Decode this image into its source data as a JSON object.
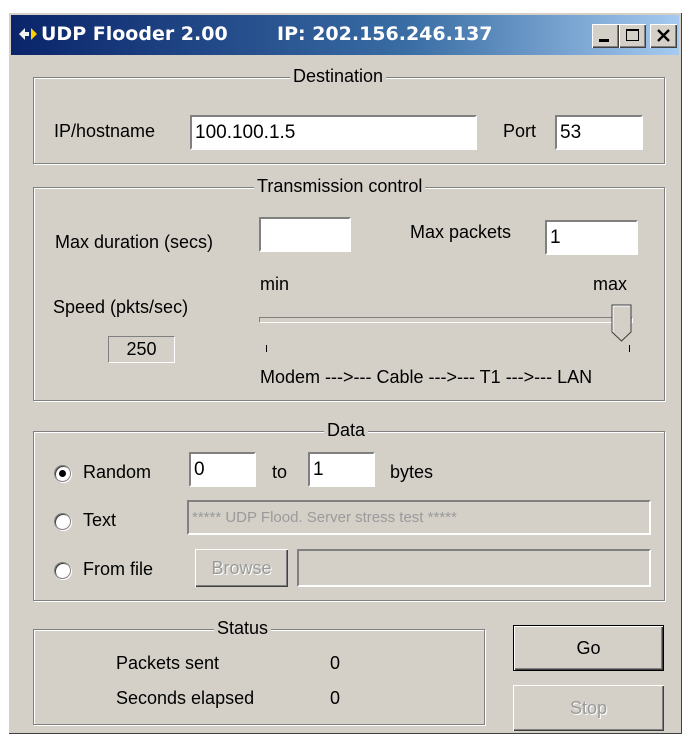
{
  "window": {
    "title": "UDP Flooder 2.00",
    "ip_label": "IP: 202.156.246.137",
    "controls": [
      "minimize",
      "maximize",
      "close"
    ]
  },
  "destination": {
    "legend": "Destination",
    "ip_label": "IP/hostname",
    "ip_value": "100.100.1.5",
    "port_label": "Port",
    "port_value": "53"
  },
  "transmission": {
    "legend": "Transmission control",
    "max_duration_label": "Max duration (secs)",
    "max_duration_value": "",
    "max_packets_label": "Max packets",
    "max_packets_value": "1",
    "speed_label": "Speed (pkts/sec)",
    "speed_value": "250",
    "slider_min": "min",
    "slider_max": "max",
    "slider_level": 1.0,
    "scale_text": "Modem --->--- Cable --->--- T1 --->--- LAN"
  },
  "data": {
    "legend": "Data",
    "random_label": "Random",
    "random_from": "0",
    "to_label": "to",
    "random_to": "1",
    "bytes_label": "bytes",
    "text_label": "Text",
    "text_value": "***** UDP Flood. Server stress test *****",
    "file_label": "From file",
    "browse_label": "Browse",
    "file_value": "",
    "selected": "random"
  },
  "status": {
    "legend": "Status",
    "packets_label": "Packets sent",
    "packets_value": "0",
    "seconds_label": "Seconds elapsed",
    "seconds_value": "0"
  },
  "buttons": {
    "go_label": "Go",
    "stop_label": "Stop"
  }
}
